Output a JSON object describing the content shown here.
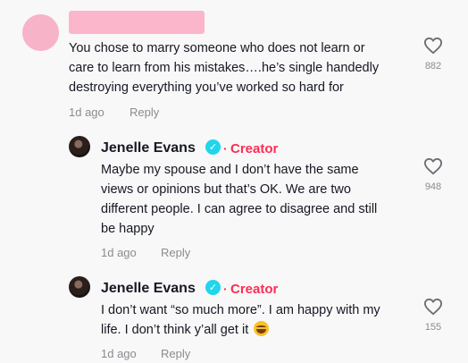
{
  "comments": [
    {
      "text_lines": [
        "You chose to marry someone who does not learn or",
        "care to learn from his mistakes….he’s single handedly",
        "destroying everything you’ve worked so hard for"
      ],
      "time": "1d ago",
      "reply_label": "Reply",
      "likes": "882",
      "colors": {
        "avatar": "#f7b3c8",
        "name_redaction": "#fbb6cc"
      }
    },
    {
      "author": "Jenelle Evans",
      "creator_separator": "·",
      "creator_label": "Creator",
      "text_lines": [
        "Maybe my spouse and I don’t have the same",
        "views or opinions but that’s OK. We are two",
        "different people. I can agree to disagree and still",
        "be happy"
      ],
      "time": "1d ago",
      "reply_label": "Reply",
      "likes": "948"
    },
    {
      "author": "Jenelle Evans",
      "creator_separator": "·",
      "creator_label": "Creator",
      "text_lines": [
        "I don’t want “so much more”. I am happy with my",
        "life. I don’t think y’all get it"
      ],
      "emoji": "laughing-face-emoji",
      "time": "1d ago",
      "reply_label": "Reply",
      "likes": "155"
    }
  ],
  "icons": {
    "like": "heart-outline-icon",
    "verified": "verified-badge-icon",
    "verified_glyph": "✓"
  },
  "colors": {
    "creator": "#fe2c55",
    "verified": "#20d5ec",
    "meta": "#8a8b91",
    "text": "#161823"
  }
}
